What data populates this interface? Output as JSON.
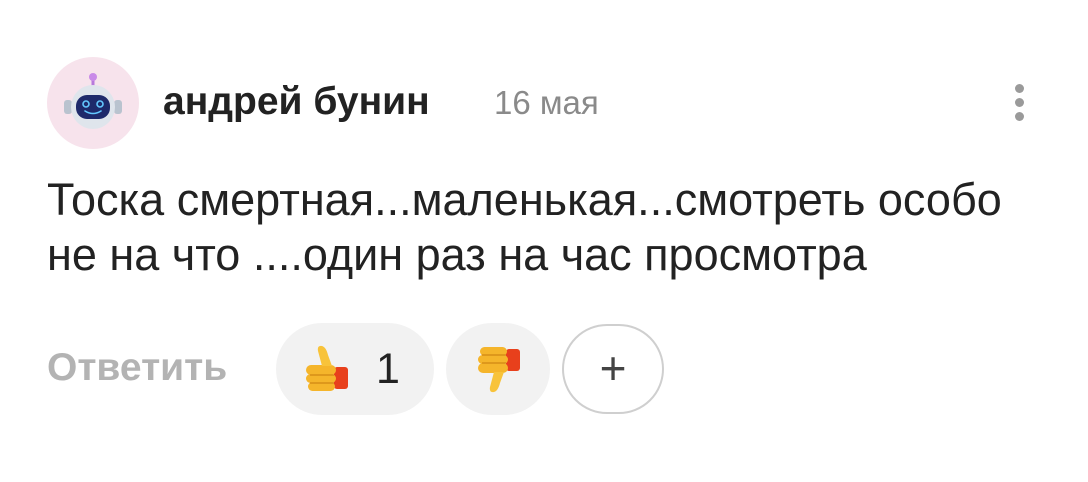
{
  "comment": {
    "author": "андрей бунин",
    "date": "16 мая",
    "text": "Тоска смертная...маленькая...смотреть особо не на что ....один раз на час просмотра",
    "avatar_icon": "robot-avatar-icon",
    "more_icon": "more-vertical-icon"
  },
  "actions": {
    "reply_label": "Ответить",
    "like_icon": "thumbs-up-icon",
    "like_count": "1",
    "dislike_icon": "thumbs-down-icon",
    "add_reaction_icon": "plus-icon",
    "add_reaction_label": "+"
  },
  "colors": {
    "text": "#222222",
    "muted": "#8a8a8a",
    "reply": "#b3b3b3",
    "pill_bg": "#f2f2f2",
    "avatar_bg": "#f7e3ec"
  }
}
